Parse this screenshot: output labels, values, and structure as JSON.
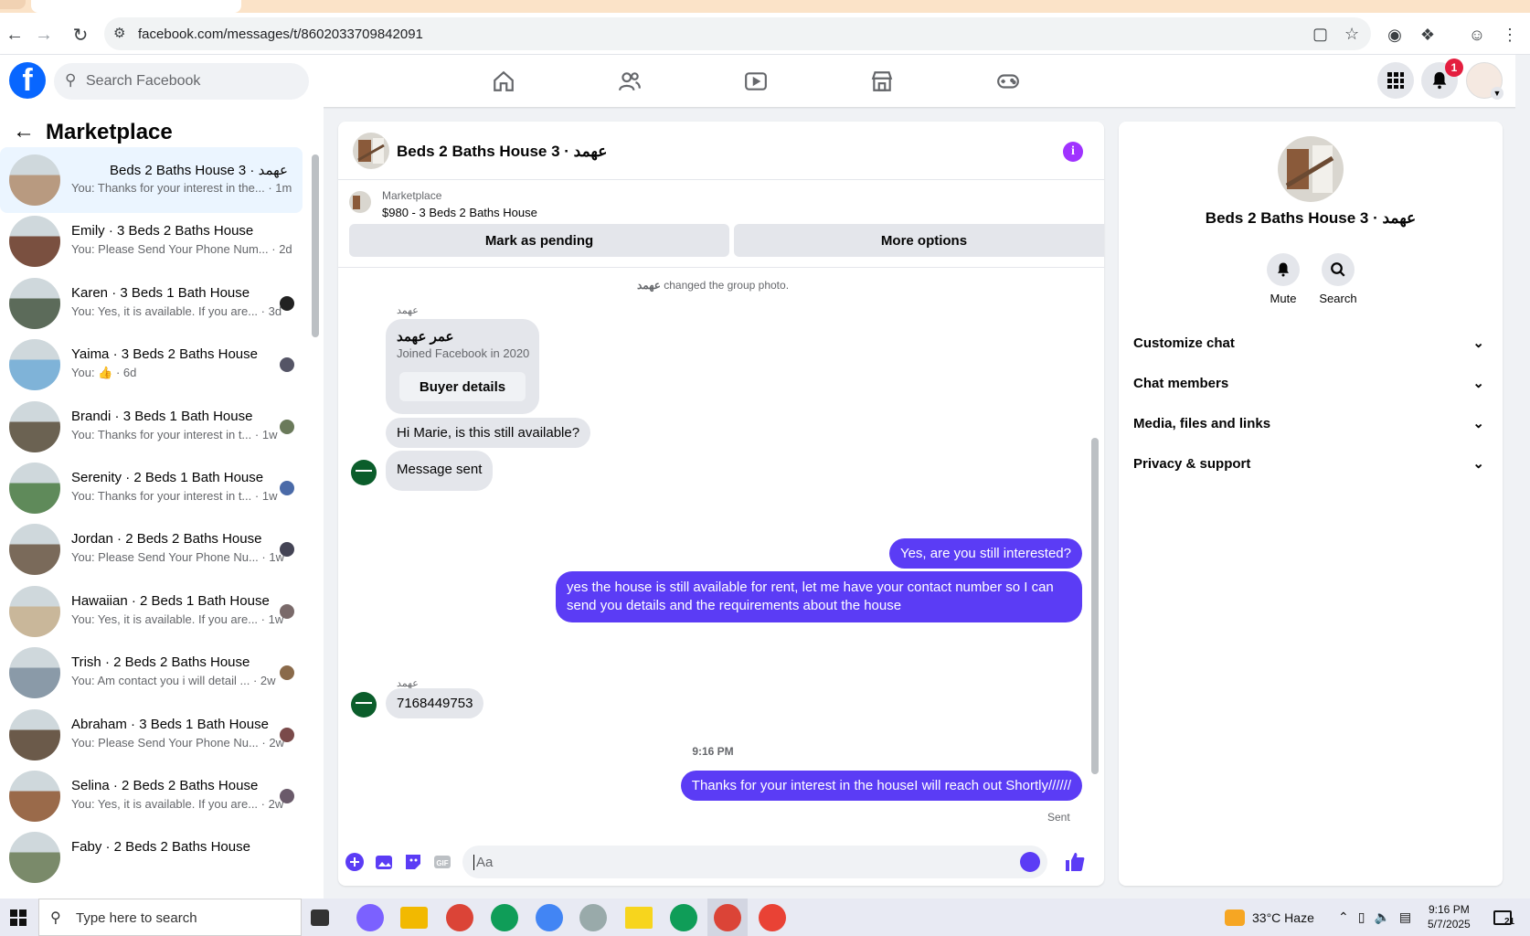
{
  "browser": {
    "url": "facebook.com/messages/t/8602033709842091"
  },
  "header": {
    "search_placeholder": "Search Facebook",
    "notifications_count": "1"
  },
  "sidebar": {
    "title": "Marketplace",
    "conversations": [
      {
        "name": "Beds 2 Baths House 3 · عهمد",
        "snippet": "You: Thanks for your interest in the...",
        "time": "1m",
        "active": true
      },
      {
        "name": "Emily · 3 Beds 2 Baths House",
        "snippet": "You: Please Send Your Phone Num...",
        "time": "2d"
      },
      {
        "name": "Karen · 3 Beds 1 Bath House",
        "snippet": "You: Yes, it is available. If you are...",
        "time": "3d"
      },
      {
        "name": "Yaima · 3 Beds 2 Baths House",
        "snippet": "You: 👍",
        "time": "6d"
      },
      {
        "name": "Brandi · 3 Beds 1 Bath House",
        "snippet": "You: Thanks for your interest in t...",
        "time": "1w"
      },
      {
        "name": "Serenity · 2 Beds 1 Bath House",
        "snippet": "You: Thanks for your interest in t...",
        "time": "1w"
      },
      {
        "name": "Jordan · 2 Beds 2 Baths House",
        "snippet": "You: Please Send Your Phone Nu...",
        "time": "1w"
      },
      {
        "name": "Hawaiian · 2 Beds 1 Bath House",
        "snippet": "You: Yes, it is available. If you are...",
        "time": "1w"
      },
      {
        "name": "Trish · 2 Beds 2 Baths House",
        "snippet": "You: Am contact you i will detail ...",
        "time": "2w"
      },
      {
        "name": "Abraham · 3 Beds 1 Bath House",
        "snippet": "You: Please Send Your Phone Nu...",
        "time": "2w"
      },
      {
        "name": "Selina · 2 Beds 2 Baths House",
        "snippet": "You: Yes, it is available. If you are...",
        "time": "2w"
      },
      {
        "name": "Faby · 2 Beds 2 Baths House",
        "snippet": "",
        "time": ""
      }
    ]
  },
  "chat": {
    "title": "Beds 2 Baths House 3 · عهمد",
    "marketplace_label": "Marketplace",
    "listing": "$980 - 3 Beds 2 Baths House",
    "mark_pending": "Mark as pending",
    "more_options": "More options",
    "system_note_name": "عهمد",
    "system_note_text": " changed the group photo.",
    "sender_name": "عهمد",
    "card_name": "عمر عهمد",
    "card_joined": "Joined Facebook in 2020",
    "buyer_details": "Buyer details",
    "msg1": "Hi Marie, is this still available?",
    "msg2": "Message sent",
    "out1": "Yes, are you still interested?",
    "out2": "yes the house is still available for rent, let me have your contact number so I can send you details and the requirements about the house",
    "sender_name2": "عهمد",
    "msg3": "7168449753",
    "timestamp": "9:16 PM",
    "out3": "Thanks for your interest in the houseI will reach out Shortly//////",
    "sent_status": "Sent",
    "composer_placeholder": "Aa"
  },
  "info": {
    "title": "Beds 2 Baths House 3 · عهمد",
    "mute": "Mute",
    "search": "Search",
    "rows": [
      "Customize chat",
      "Chat members",
      "Media, files and links",
      "Privacy & support"
    ]
  },
  "taskbar": {
    "search_placeholder": "Type here to search",
    "weather": "33°C  Haze",
    "time": "9:16 PM",
    "date": "5/7/2025",
    "notif": "21"
  }
}
